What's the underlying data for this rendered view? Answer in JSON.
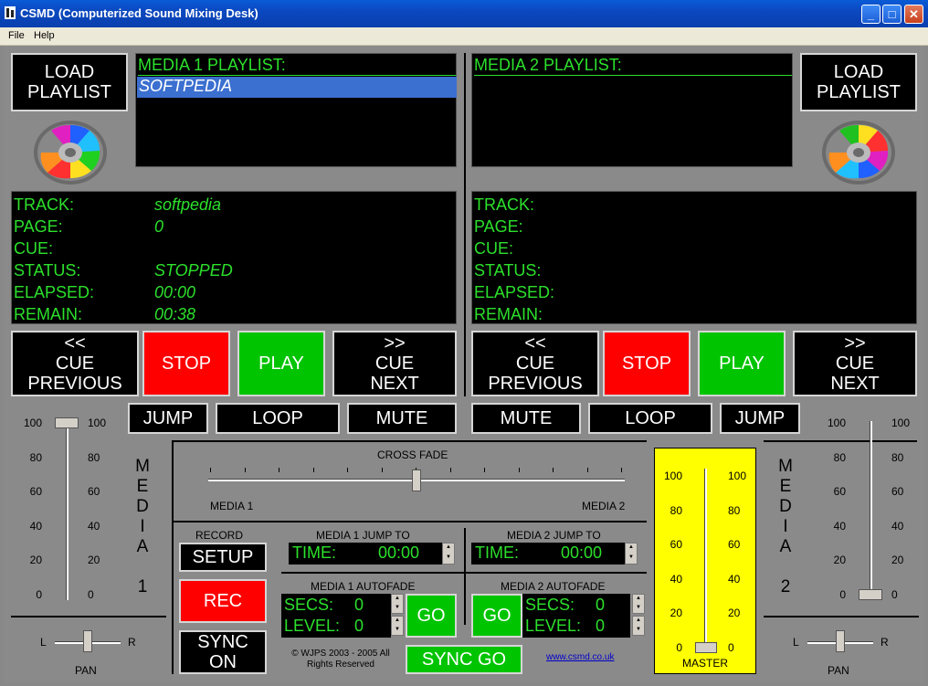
{
  "window": {
    "title": "CSMD (Computerized Sound Mixing Desk)",
    "minimize": "_",
    "maximize": "□",
    "close": "✕"
  },
  "menu": {
    "file": "File",
    "help": "Help"
  },
  "deck1": {
    "load_l1": "LOAD",
    "load_l2": "PLAYLIST",
    "playlist_title": "MEDIA 1 PLAYLIST:",
    "playlist_items": [
      "SOFTPEDIA"
    ],
    "labels": {
      "track": "TRACK:",
      "page": "PAGE:",
      "cue": "CUE:",
      "status": "STATUS:",
      "elapsed": "ELAPSED:",
      "remain": "REMAIN:"
    },
    "values": {
      "track": "softpedia",
      "page": "0",
      "cue": "",
      "status": "STOPPED",
      "elapsed": "00:00",
      "remain": "00:38"
    },
    "cue_prev": {
      "arrow": "<<",
      "l1": "CUE",
      "l2": "PREVIOUS"
    },
    "stop": "STOP",
    "play": "PLAY",
    "cue_next": {
      "arrow": ">>",
      "l1": "CUE",
      "l2": "NEXT"
    },
    "jump": "JUMP",
    "loop": "LOOP",
    "mute": "MUTE",
    "vertical_label": [
      "M",
      "E",
      "D",
      "I",
      "A",
      " ",
      "1"
    ],
    "pan_label": "PAN",
    "pan_l": "L",
    "pan_r": "R"
  },
  "deck2": {
    "load_l1": "LOAD",
    "load_l2": "PLAYLIST",
    "playlist_title": "MEDIA  2 PLAYLIST:",
    "labels": {
      "track": "TRACK:",
      "page": "PAGE:",
      "cue": "CUE:",
      "status": "STATUS:",
      "elapsed": "ELAPSED:",
      "remain": "REMAIN:"
    },
    "cue_prev": {
      "arrow": "<<",
      "l1": "CUE",
      "l2": "PREVIOUS"
    },
    "stop": "STOP",
    "play": "PLAY",
    "cue_next": {
      "arrow": ">>",
      "l1": "CUE",
      "l2": "NEXT"
    },
    "mute": "MUTE",
    "loop": "LOOP",
    "jump": "JUMP",
    "vertical_label": [
      "M",
      "E",
      "D",
      "I",
      "A",
      " ",
      "2"
    ],
    "pan_label": "PAN",
    "pan_l": "L",
    "pan_r": "R"
  },
  "fader_ticks": [
    "100",
    "80",
    "60",
    "40",
    "20",
    "0"
  ],
  "crossfade": {
    "title": "CROSS FADE",
    "left": "MEDIA 1",
    "right": "MEDIA 2"
  },
  "record": {
    "title": "RECORD",
    "setup": "SETUP",
    "rec": "REC",
    "sync_l1": "SYNC",
    "sync_l2": "ON"
  },
  "jump_to1": {
    "title": "MEDIA 1 JUMP TO",
    "label": "TIME:",
    "value": "00:00"
  },
  "jump_to2": {
    "title": "MEDIA 2 JUMP TO",
    "label": "TIME:",
    "value": "00:00"
  },
  "autofade1": {
    "title": "MEDIA 1 AUTOFADE",
    "secs_label": "SECS:",
    "secs": "0",
    "level_label": "LEVEL:",
    "level": "0",
    "go": "GO"
  },
  "autofade2": {
    "title": "MEDIA 2 AUTOFADE",
    "secs_label": "SECS:",
    "secs": "0",
    "level_label": "LEVEL:",
    "level": "0",
    "go": "GO"
  },
  "sync_go": "SYNC GO",
  "copyright_l1": "© WJPS 2003 - 2005 All",
  "copyright_l2": "Rights Reserved",
  "website": "www.csmd.co.uk",
  "master": {
    "label": "MASTER"
  },
  "levels": {
    "deck1_fader": 100,
    "deck2_fader": 0,
    "master_fader": 0,
    "crossfade": 0.5,
    "pan1": 0.5,
    "pan2": 0.5
  },
  "colors": {
    "green_text": "#2ce02c",
    "stop_red": "#ff0000",
    "play_green": "#00c400",
    "master_yellow": "#ffff00",
    "selection_blue": "#3b6fd0"
  }
}
